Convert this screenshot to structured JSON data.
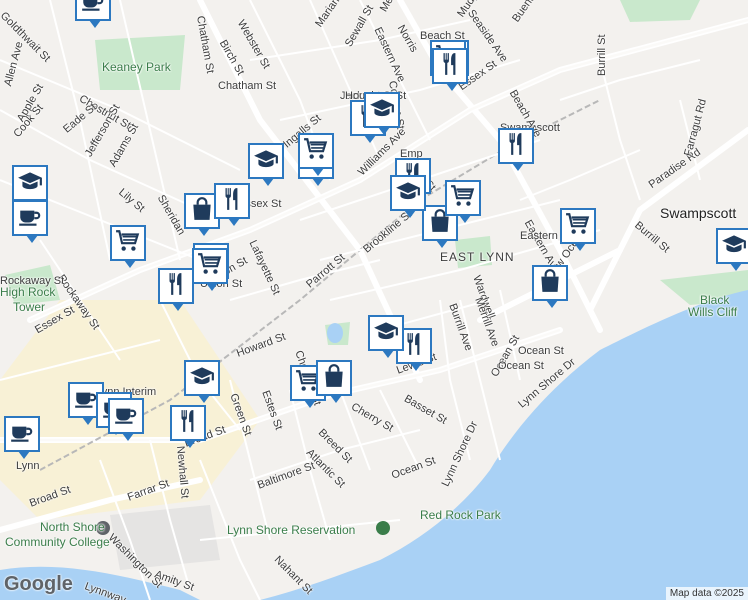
{
  "map": {
    "attribution": "Map data ©2025",
    "logo": "Google",
    "places": [
      {
        "text": "Swampscott",
        "cls": "big"
      },
      {
        "text": "EAST LYNN",
        "cls": "place"
      },
      {
        "text": "Keaney Park",
        "cls": "park"
      },
      {
        "text": "High Rock",
        "cls": "park"
      },
      {
        "text": "Tower",
        "cls": "park"
      },
      {
        "text": "Red Rock Park",
        "cls": "park"
      },
      {
        "text": "Lynn Shore Reservation",
        "cls": "park"
      },
      {
        "text": "Black",
        "cls": "park"
      },
      {
        "text": "Wills Cliff",
        "cls": "park"
      },
      {
        "text": "North Shore",
        "cls": "park"
      },
      {
        "text": "Community College",
        "cls": "park"
      },
      {
        "text": "Lynn",
        "cls": ""
      },
      {
        "text": "Swampscott",
        "cls": ""
      },
      {
        "text": "Lynn Interim",
        "cls": ""
      }
    ],
    "streets": [
      "Goldthwait St",
      "Chatham St",
      "Webster St",
      "Birch St",
      "Marianna St",
      "Sewall St",
      "Melvin",
      "Eastern Ave",
      "Norris",
      "Cobum St",
      "Mudge St",
      "Seaside Ave",
      "Buena",
      "Essex St",
      "Beach Ave",
      "Burrill St",
      "Chestnut St",
      "Allen Ave",
      "Apple St",
      "Eade St",
      "Cook St",
      "Jefferson St",
      "Adams St",
      "Lily St",
      "Sheridan",
      "Ingalls St",
      "Williams Ave",
      "Tirrell St",
      "Lafayette St",
      "Brookline St",
      "Parrott St",
      "Union St",
      "Rockaway St",
      "Essex St",
      "Paradise Rd",
      "Farragut Rd",
      "Burrill St",
      "Eastern Ave",
      "New Ocean St",
      "Wardwell",
      "Merrill Ave",
      "Burrill Ave",
      "Ocean St",
      "Lynn Shore Dr",
      "Lynn Shore Dr",
      "Lewis St",
      "Basset St",
      "Cherry St",
      "Breed St",
      "Atlantic St",
      "Ocean St",
      "Howard St",
      "Estes St",
      "Green St",
      "Chestnut St",
      "Broad St",
      "Broad St",
      "Baltimore St",
      "Farrar St",
      "Washington St",
      "Newhall St",
      "Amity St",
      "Nahant St",
      "Lynnway",
      "Rockaway St",
      "Union St",
      "Chatham St",
      "Essex St",
      "Jackson St",
      "Eastern Ave",
      "Ocean St",
      "Emp",
      "Houghton St",
      "Beach St",
      "Ocean St"
    ],
    "pins": [
      {
        "icon": "coffee-icon"
      },
      {
        "icon": "school-icon"
      },
      {
        "icon": "coffee-icon"
      },
      {
        "icon": "restaurant-icon"
      },
      {
        "icon": "shopping-cart-icon"
      },
      {
        "icon": "restaurant-icon"
      },
      {
        "icon": "restaurant-icon"
      },
      {
        "icon": "school-icon"
      },
      {
        "icon": "shopping-cart-icon"
      },
      {
        "icon": "shopping-cart-icon"
      },
      {
        "icon": "shopping-bag-icon"
      },
      {
        "icon": "restaurant-icon"
      },
      {
        "icon": "shopping-bag-icon"
      },
      {
        "icon": "shopping-cart-icon"
      },
      {
        "icon": "restaurant-icon"
      },
      {
        "icon": "shopping-cart-icon"
      },
      {
        "icon": "restaurant-icon"
      },
      {
        "icon": "school-icon"
      },
      {
        "icon": "shopping-cart-icon"
      },
      {
        "icon": "shopping-bag-icon"
      },
      {
        "icon": "shopping-cart-icon"
      },
      {
        "icon": "school-icon"
      },
      {
        "icon": "restaurant-icon"
      },
      {
        "icon": "shopping-cart-icon"
      },
      {
        "icon": "shopping-bag-icon"
      },
      {
        "icon": "coffee-icon"
      },
      {
        "icon": "school-icon"
      },
      {
        "icon": "restaurant-icon"
      },
      {
        "icon": "coffee-icon"
      },
      {
        "icon": "coffee-icon"
      },
      {
        "icon": "coffee-icon"
      },
      {
        "icon": "school-icon"
      },
      {
        "icon": "restaurant-icon"
      },
      {
        "icon": "shopping-cart-icon"
      },
      {
        "icon": "school-icon"
      }
    ]
  }
}
